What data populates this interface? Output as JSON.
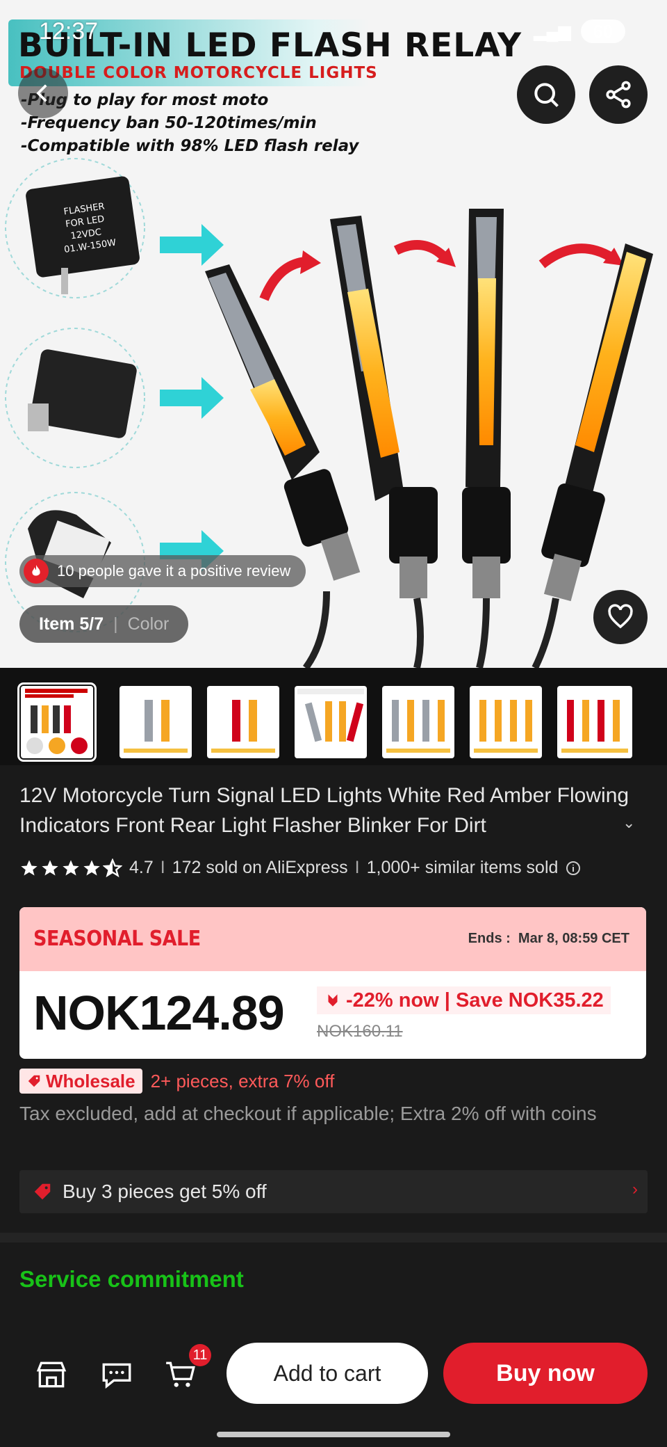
{
  "status_bar": {
    "time": "12:37",
    "battery": "60"
  },
  "hero": {
    "title": "BUILT-IN LED FLASH RELAY",
    "subtitle": "DOUBLE COLOR MOTORCYCLE LIGHTS",
    "bullets": [
      "-Plug to play for most moto",
      "-Frequency ban 50-120times/min",
      "-Compatible with 98% LED flash relay"
    ],
    "flasher_label": [
      "FLASHER",
      "FOR LED",
      "12VDC",
      "01.W-150W"
    ],
    "review_text": "10 people gave it a positive review",
    "item_label": "Item 5/7",
    "color_label": "Color"
  },
  "thumbnails": {
    "count": 7,
    "selected_index": 0
  },
  "product": {
    "title": "12V Motorcycle Turn Signal LED Lights White Red Amber Flowing Indicators Front Rear Light Flasher Blinker For Dirt",
    "rating": "4.7",
    "sold": "172 sold on AliExpress",
    "similar": "1,000+ similar items sold",
    "separator": "I"
  },
  "sale": {
    "label": "SEASONAL SALE",
    "ends_label": "Ends :",
    "ends_date": "Mar 8, 08:59 CET",
    "price": "NOK124.89",
    "discount": "-22% now | Save NOK35.22",
    "old_price": "NOK160.11"
  },
  "wholesale": {
    "tag": "Wholesale",
    "text": "2+ pieces, extra 7% off"
  },
  "tax_note": "Tax excluded, add at checkout if applicable; Extra 2% off with coins",
  "promo": {
    "text": "Buy 3 pieces get 5% off"
  },
  "service": {
    "title": "Service commitment"
  },
  "bottom_bar": {
    "cart_count": "11",
    "add_to_cart": "Add to cart",
    "buy_now": "Buy now"
  },
  "colors": {
    "accent": "#e11e2c",
    "service_green": "#18c218",
    "sale_bg": "#ffc5c5"
  }
}
